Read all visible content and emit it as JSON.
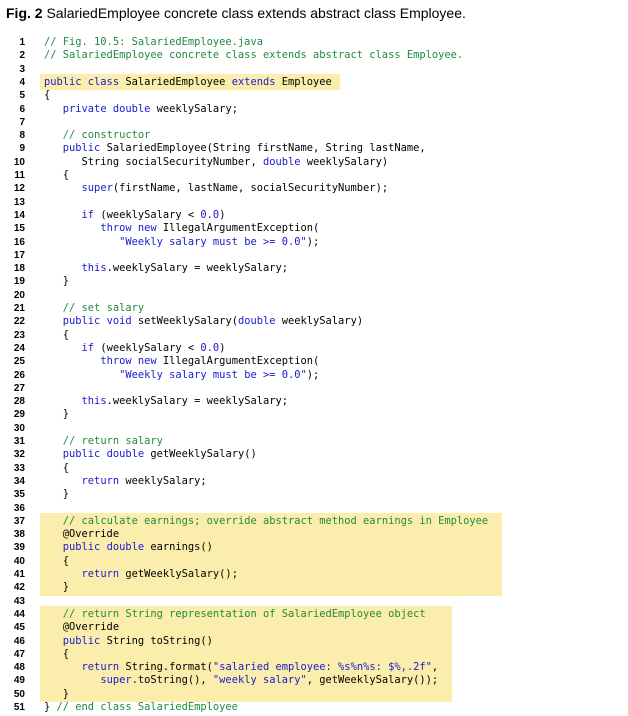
{
  "figure": {
    "label": "Fig. 2",
    "caption": "SalariedEmployee concrete class extends abstract class Employee."
  },
  "lines": [
    {
      "n": "1",
      "hl": false,
      "t": [
        [
          "cm",
          "// Fig. 10.5: SalariedEmployee.java"
        ]
      ]
    },
    {
      "n": "2",
      "hl": false,
      "t": [
        [
          "cm",
          "// SalariedEmployee concrete class extends abstract class Employee."
        ]
      ]
    },
    {
      "n": "3",
      "hl": false,
      "t": []
    },
    {
      "n": "4",
      "hl": true,
      "t": [
        [
          "kw",
          "public class "
        ],
        [
          "",
          "SalariedEmployee "
        ],
        [
          "kw",
          "extends "
        ],
        [
          "",
          "Employee"
        ]
      ]
    },
    {
      "n": "5",
      "hl": false,
      "t": [
        [
          "",
          "{"
        ]
      ]
    },
    {
      "n": "6",
      "hl": false,
      "t": [
        [
          "",
          "   "
        ],
        [
          "kw",
          "private double "
        ],
        [
          "",
          "weeklySalary;"
        ]
      ]
    },
    {
      "n": "7",
      "hl": false,
      "t": []
    },
    {
      "n": "8",
      "hl": false,
      "t": [
        [
          "",
          "   "
        ],
        [
          "cm",
          "// constructor"
        ]
      ]
    },
    {
      "n": "9",
      "hl": false,
      "t": [
        [
          "",
          "   "
        ],
        [
          "kw",
          "public "
        ],
        [
          "",
          "SalariedEmployee(String firstName, String lastName,"
        ]
      ]
    },
    {
      "n": "10",
      "hl": false,
      "t": [
        [
          "",
          "      String socialSecurityNumber, "
        ],
        [
          "kw",
          "double "
        ],
        [
          "",
          "weeklySalary)"
        ]
      ]
    },
    {
      "n": "11",
      "hl": false,
      "t": [
        [
          "",
          "   {"
        ]
      ]
    },
    {
      "n": "12",
      "hl": false,
      "t": [
        [
          "",
          "      "
        ],
        [
          "kw",
          "super"
        ],
        [
          "",
          "(firstName, lastName, socialSecurityNumber);"
        ]
      ]
    },
    {
      "n": "13",
      "hl": false,
      "t": []
    },
    {
      "n": "14",
      "hl": false,
      "t": [
        [
          "",
          "      "
        ],
        [
          "kw",
          "if "
        ],
        [
          "",
          "(weeklySalary < "
        ],
        [
          "num",
          "0.0"
        ],
        [
          "",
          ")"
        ]
      ]
    },
    {
      "n": "15",
      "hl": false,
      "t": [
        [
          "",
          "         "
        ],
        [
          "kw",
          "throw new "
        ],
        [
          "",
          "IllegalArgumentException("
        ]
      ]
    },
    {
      "n": "16",
      "hl": false,
      "t": [
        [
          "",
          "            "
        ],
        [
          "st",
          "\"Weekly salary must be >= 0.0\""
        ],
        [
          "",
          ");"
        ]
      ]
    },
    {
      "n": "17",
      "hl": false,
      "t": []
    },
    {
      "n": "18",
      "hl": false,
      "t": [
        [
          "",
          "      "
        ],
        [
          "kw",
          "this"
        ],
        [
          "",
          ".weeklySalary = weeklySalary;"
        ]
      ]
    },
    {
      "n": "19",
      "hl": false,
      "t": [
        [
          "",
          "   }"
        ]
      ]
    },
    {
      "n": "20",
      "hl": false,
      "t": []
    },
    {
      "n": "21",
      "hl": false,
      "t": [
        [
          "",
          "   "
        ],
        [
          "cm",
          "// set salary"
        ]
      ]
    },
    {
      "n": "22",
      "hl": false,
      "t": [
        [
          "",
          "   "
        ],
        [
          "kw",
          "public void "
        ],
        [
          "",
          "setWeeklySalary("
        ],
        [
          "kw",
          "double "
        ],
        [
          "",
          "weeklySalary)"
        ]
      ]
    },
    {
      "n": "23",
      "hl": false,
      "t": [
        [
          "",
          "   {"
        ]
      ]
    },
    {
      "n": "24",
      "hl": false,
      "t": [
        [
          "",
          "      "
        ],
        [
          "kw",
          "if "
        ],
        [
          "",
          "(weeklySalary < "
        ],
        [
          "num",
          "0.0"
        ],
        [
          "",
          ")"
        ]
      ]
    },
    {
      "n": "25",
      "hl": false,
      "t": [
        [
          "",
          "         "
        ],
        [
          "kw",
          "throw new "
        ],
        [
          "",
          "IllegalArgumentException("
        ]
      ]
    },
    {
      "n": "26",
      "hl": false,
      "t": [
        [
          "",
          "            "
        ],
        [
          "st",
          "\"Weekly salary must be >= 0.0\""
        ],
        [
          "",
          ");"
        ]
      ]
    },
    {
      "n": "27",
      "hl": false,
      "t": []
    },
    {
      "n": "28",
      "hl": false,
      "t": [
        [
          "",
          "      "
        ],
        [
          "kw",
          "this"
        ],
        [
          "",
          ".weeklySalary = weeklySalary;"
        ]
      ]
    },
    {
      "n": "29",
      "hl": false,
      "t": [
        [
          "",
          "   }"
        ]
      ]
    },
    {
      "n": "30",
      "hl": false,
      "t": []
    },
    {
      "n": "31",
      "hl": false,
      "t": [
        [
          "",
          "   "
        ],
        [
          "cm",
          "// return salary"
        ]
      ]
    },
    {
      "n": "32",
      "hl": false,
      "t": [
        [
          "",
          "   "
        ],
        [
          "kw",
          "public double "
        ],
        [
          "",
          "getWeeklySalary()"
        ]
      ]
    },
    {
      "n": "33",
      "hl": false,
      "t": [
        [
          "",
          "   {"
        ]
      ]
    },
    {
      "n": "34",
      "hl": false,
      "t": [
        [
          "",
          "      "
        ],
        [
          "kw",
          "return "
        ],
        [
          "",
          "weeklySalary;"
        ]
      ]
    },
    {
      "n": "35",
      "hl": false,
      "t": [
        [
          "",
          "   }"
        ]
      ]
    },
    {
      "n": "36",
      "hl": false,
      "t": []
    },
    {
      "n": "37",
      "hl": true,
      "t": [
        [
          "",
          "   "
        ],
        [
          "cm",
          "// calculate earnings; override abstract method earnings in Employee"
        ]
      ]
    },
    {
      "n": "38",
      "hl": true,
      "t": [
        [
          "",
          "   @Override"
        ]
      ]
    },
    {
      "n": "39",
      "hl": true,
      "t": [
        [
          "",
          "   "
        ],
        [
          "kw",
          "public double "
        ],
        [
          "",
          "earnings()"
        ]
      ]
    },
    {
      "n": "40",
      "hl": true,
      "t": [
        [
          "",
          "   {"
        ]
      ]
    },
    {
      "n": "41",
      "hl": true,
      "t": [
        [
          "",
          "      "
        ],
        [
          "kw",
          "return "
        ],
        [
          "",
          "getWeeklySalary();"
        ]
      ]
    },
    {
      "n": "42",
      "hl": true,
      "t": [
        [
          "",
          "   }"
        ]
      ]
    },
    {
      "n": "43",
      "hl": false,
      "t": []
    },
    {
      "n": "44",
      "hl": true,
      "t": [
        [
          "",
          "   "
        ],
        [
          "cm",
          "// return String representation of SalariedEmployee object"
        ]
      ]
    },
    {
      "n": "45",
      "hl": true,
      "t": [
        [
          "",
          "   @Override"
        ]
      ]
    },
    {
      "n": "46",
      "hl": true,
      "t": [
        [
          "",
          "   "
        ],
        [
          "kw",
          "public "
        ],
        [
          "",
          "String toString()"
        ]
      ]
    },
    {
      "n": "47",
      "hl": true,
      "t": [
        [
          "",
          "   {"
        ]
      ]
    },
    {
      "n": "48",
      "hl": true,
      "t": [
        [
          "",
          "      "
        ],
        [
          "kw",
          "return "
        ],
        [
          "",
          "String.format("
        ],
        [
          "st",
          "\"salaried employee: %s%n%s: $%,.2f\""
        ],
        [
          "",
          ","
        ]
      ]
    },
    {
      "n": "49",
      "hl": true,
      "t": [
        [
          "",
          "         "
        ],
        [
          "kw",
          "super"
        ],
        [
          "",
          ".toString(), "
        ],
        [
          "st",
          "\"weekly salary\""
        ],
        [
          "",
          ", getWeeklySalary());"
        ]
      ]
    },
    {
      "n": "50",
      "hl": true,
      "t": [
        [
          "",
          "   }"
        ]
      ]
    },
    {
      "n": "51",
      "hl": false,
      "t": [
        [
          "",
          "} "
        ],
        [
          "cm",
          "// end class SalariedEmployee"
        ]
      ]
    }
  ],
  "highlight_blocks": [
    {
      "start": "4",
      "end": "4"
    },
    {
      "start": "37",
      "end": "42"
    },
    {
      "start": "44",
      "end": "50"
    }
  ]
}
